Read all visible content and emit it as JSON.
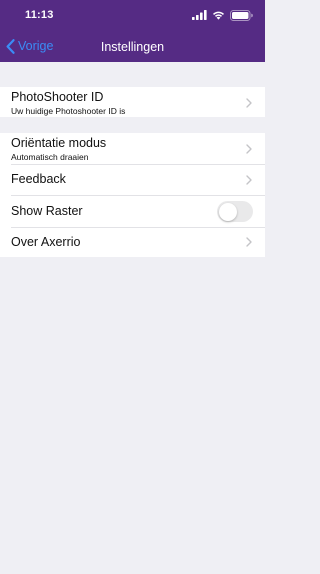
{
  "status_bar": {
    "time": "11:13",
    "icons": [
      "cellular-signal-icon",
      "wifi-icon",
      "battery-icon"
    ]
  },
  "nav": {
    "back_label": "Vorige",
    "title": "Instellingen",
    "back_icon": "chevron-left-icon"
  },
  "settings": {
    "id_row": {
      "title": "PhotoShooter ID",
      "subtitle": "Uw huidige Photoshooter ID is"
    },
    "orientation_row": {
      "title": "Oriëntatie modus",
      "subtitle": "Automatisch draaien"
    },
    "feedback_row": {
      "title": "Feedback"
    },
    "raster_row": {
      "title": "Show Raster",
      "toggle_on": false
    },
    "about_row": {
      "title": "Over Axerrio"
    }
  },
  "colors": {
    "header": "#552b84",
    "accent": "#3b8cf6",
    "background": "#efeff4",
    "toggle_off": "#e9e9ea",
    "chevron": "#c4c4c7"
  }
}
